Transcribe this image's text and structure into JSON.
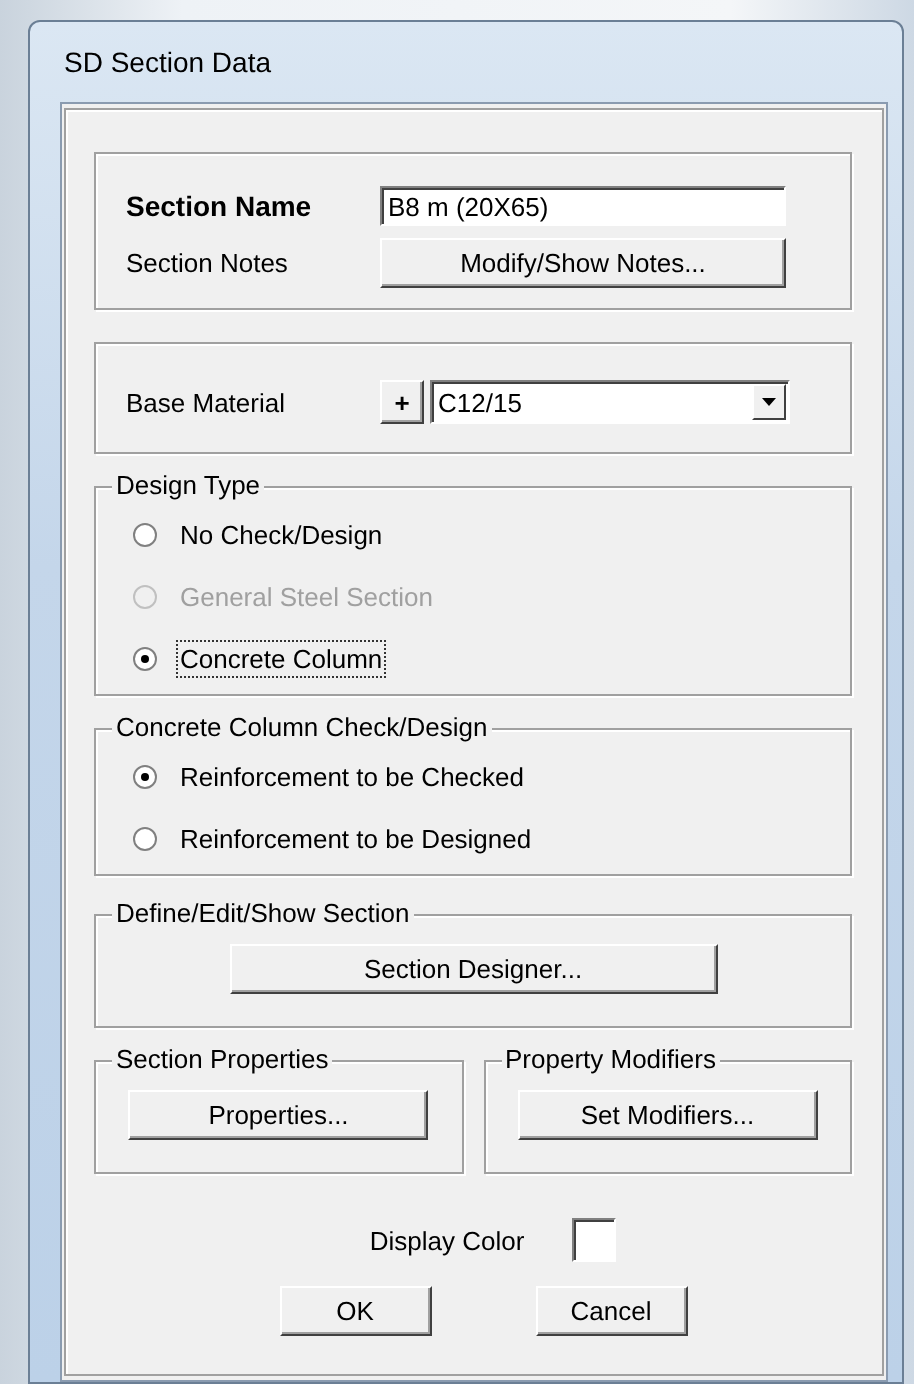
{
  "window": {
    "title": "SD Section Data"
  },
  "section_name": {
    "label": "Section Name",
    "value": "B8 m (20X65)"
  },
  "section_notes": {
    "label": "Section Notes",
    "button": "Modify/Show Notes..."
  },
  "base_material": {
    "label": "Base Material",
    "add_button": "+",
    "value": "C12/15"
  },
  "design_type": {
    "title": "Design Type",
    "options": [
      {
        "label": "No Check/Design",
        "selected": false,
        "disabled": false,
        "focused": false
      },
      {
        "label": "General Steel Section",
        "selected": false,
        "disabled": true,
        "focused": false
      },
      {
        "label": "Concrete Column",
        "selected": true,
        "disabled": false,
        "focused": true
      }
    ]
  },
  "column_check": {
    "title": "Concrete Column Check/Design",
    "options": [
      {
        "label": "Reinforcement to be Checked",
        "selected": true,
        "disabled": false,
        "focused": false
      },
      {
        "label": "Reinforcement to be Designed",
        "selected": false,
        "disabled": false,
        "focused": false
      }
    ]
  },
  "define_section": {
    "title": "Define/Edit/Show Section",
    "button": "Section Designer..."
  },
  "section_properties": {
    "title": "Section Properties",
    "button": "Properties..."
  },
  "property_modifiers": {
    "title": "Property Modifiers",
    "button": "Set Modifiers..."
  },
  "display_color": {
    "label": "Display Color"
  },
  "buttons": [
    "OK",
    "Cancel"
  ]
}
